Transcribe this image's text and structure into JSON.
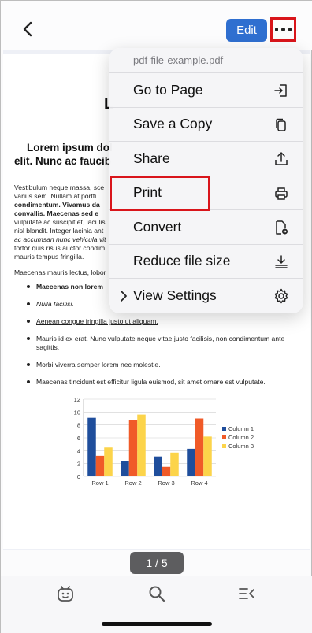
{
  "toolbar": {
    "edit_label": "Edit"
  },
  "document": {
    "title": "L",
    "heading_line1": "Lorem ipsum dol",
    "heading_line2": "elit. Nunc ac faucib",
    "para1_lines": [
      "Vestibulum neque massa, sce",
      "varius sem. Nullam at portti",
      "condimentum. Vivamus da",
      "convallis. Maecenas sed e",
      "vulputate ac suscipit et, iaculis",
      "nisl blandit. Integer lacinia ant",
      "ac accumsan nunc vehicula vit",
      "tortor quis risus auctor condim",
      "mauris tempus fringilla."
    ],
    "para2": "Maecenas mauris lectus, lobor",
    "bullets": [
      "Maecenas non lorem",
      "Nulla facilisi.",
      "Aenean congue fringilla justo ut aliquam.",
      "Mauris id ex erat. Nunc vulputate neque vitae justo facilisis, non condimentum ante sagittis.",
      "Morbi viverra semper lorem nec molestie.",
      "Maecenas tincidunt est efficitur ligula euismod, sit amet ornare est vulputate."
    ]
  },
  "chart_data": {
    "type": "bar",
    "categories": [
      "Row 1",
      "Row 2",
      "Row 3",
      "Row 4"
    ],
    "series": [
      {
        "name": "Column 1",
        "values": [
          9.1,
          2.4,
          3.1,
          4.3
        ],
        "color": "#1f4e9c"
      },
      {
        "name": "Column 2",
        "values": [
          3.2,
          8.8,
          1.5,
          9.0
        ],
        "color": "#f05a28"
      },
      {
        "name": "Column 3",
        "values": [
          4.5,
          9.6,
          3.7,
          6.2
        ],
        "color": "#fcd44a"
      }
    ],
    "yticks": [
      "0",
      "2",
      "4",
      "6",
      "8",
      "10",
      "12"
    ],
    "ylim": [
      0,
      12
    ],
    "grid": true,
    "legend": "right"
  },
  "page_indicator": "1 / 5",
  "menu": {
    "file_name": "pdf-file-example.pdf",
    "items": [
      {
        "label": "Go to Page",
        "icon": "go-to-page-icon"
      },
      {
        "label": "Save a Copy",
        "icon": "copy-icon"
      },
      {
        "label": "Share",
        "icon": "share-icon"
      },
      {
        "label": "Print",
        "icon": "printer-icon"
      },
      {
        "label": "Convert",
        "icon": "convert-icon"
      },
      {
        "label": "Reduce file size",
        "icon": "reduce-size-icon"
      },
      {
        "label": "View Settings",
        "icon": "settings-icon"
      }
    ]
  },
  "colors": {
    "accent": "#2f6fd0",
    "highlight": "#d9151b"
  }
}
